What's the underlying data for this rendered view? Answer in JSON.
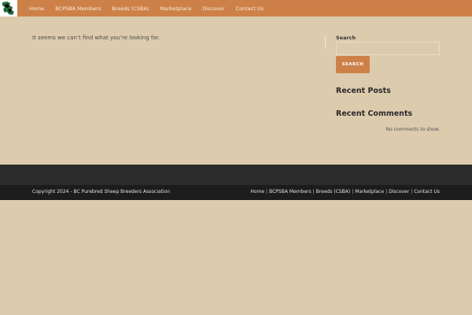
{
  "header": {
    "logo_icon": "sheep-map-logo-icon",
    "nav": [
      {
        "label": "Home"
      },
      {
        "label": "BCPSBA Members"
      },
      {
        "label": "Breeds (CSBA)"
      },
      {
        "label": "Marketplace"
      },
      {
        "label": "Discover"
      },
      {
        "label": "Contact Us"
      }
    ]
  },
  "main": {
    "message": "It seems we can’t find what you’re looking for."
  },
  "sidebar": {
    "search_label": "Search",
    "search_value": "",
    "search_button": "SEARCH",
    "recent_posts_title": "Recent Posts",
    "recent_comments_title": "Recent Comments",
    "no_comments": "No comments to show."
  },
  "footer": {
    "copyright": "Copyright 2024 - BC Purebred Sheep Breeders Association",
    "links": [
      {
        "label": "Home"
      },
      {
        "label": "BCPSBA Members"
      },
      {
        "label": "Breeds (CSBA)"
      },
      {
        "label": "Marketplace"
      },
      {
        "label": "Discover"
      },
      {
        "label": "Contact Us"
      }
    ],
    "separator": "|"
  },
  "colors": {
    "accent": "#cd8148",
    "background": "#ddcbae",
    "footer_top": "#2b2b2b",
    "footer_bottom": "#1c1c1c"
  }
}
